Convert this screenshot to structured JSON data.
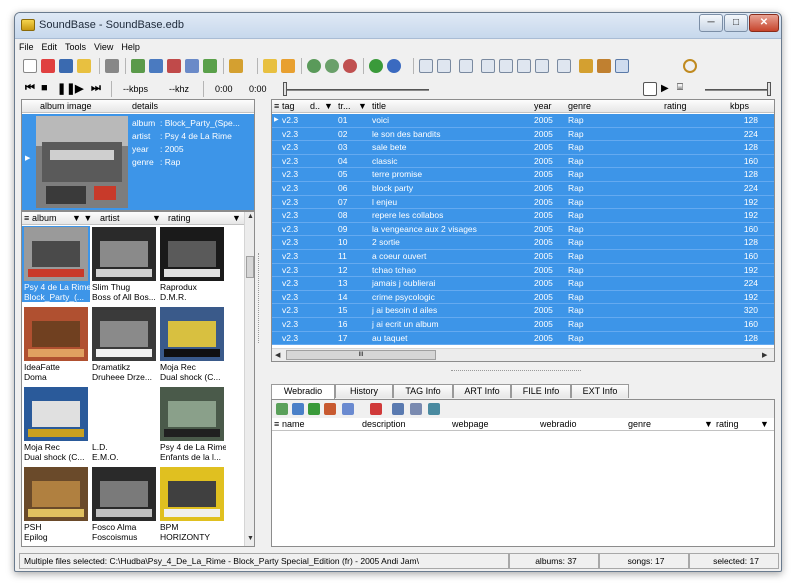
{
  "window": {
    "title": "SoundBase - SoundBase.edb",
    "buttons": {
      "minimize": "─",
      "maximize": "□",
      "close": "✕"
    }
  },
  "menu": [
    "File",
    "Edit",
    "Tools",
    "View",
    "Help"
  ],
  "player": {
    "kbps": "--kbps",
    "khz": "--khz",
    "time1": "0:00",
    "time2": "0:00"
  },
  "colors": {
    "selection": "#3d95e8",
    "window": "#f0f0f0"
  },
  "detail_panel": {
    "headers": {
      "image": "album image",
      "details": "details"
    },
    "fields": [
      {
        "key": "album",
        "value": ": Block_Party_(Spe..."
      },
      {
        "key": "artist",
        "value": ": Psy 4 de La Rime"
      },
      {
        "key": "year",
        "value": ": 2005"
      },
      {
        "key": "genre",
        "value": ": Rap"
      }
    ]
  },
  "album_browser": {
    "headers": {
      "album": "album",
      "artist": "artist",
      "rating": "rating"
    },
    "albums": [
      {
        "line1": "Psy 4 de La Rime",
        "line2": "Block_Party_(...",
        "selected": true
      },
      {
        "line1": "Slim Thug",
        "line2": "Boss of All Bos..."
      },
      {
        "line1": "Raprodux",
        "line2": "D.M.R."
      },
      {
        "line1": "IdeaFatte",
        "line2": "Doma"
      },
      {
        "line1": "Dramatikz",
        "line2": "Druheee Drze..."
      },
      {
        "line1": "Moja Rec",
        "line2": "Dual shock (C..."
      },
      {
        "line1": "Moja Rec",
        "line2": "Dual shock (C..."
      },
      {
        "line1": "L.D.",
        "line2": "E.M.O."
      },
      {
        "line1": "Psy 4 de La Rime",
        "line2": "Enfants de la l..."
      },
      {
        "line1": "PSH",
        "line2": "Epilog"
      },
      {
        "line1": "Fosco Alma",
        "line2": "Foscoismus"
      },
      {
        "line1": "BPM",
        "line2": "HORIZONTY"
      }
    ]
  },
  "tracklist": {
    "headers": {
      "tag": "tag",
      "d": "d..",
      "tr": "tr...",
      "title": "title",
      "year": "year",
      "genre": "genre",
      "rating": "rating",
      "kbps": "kbps"
    },
    "rows": [
      {
        "tag": "v2.3",
        "tr": "01",
        "title": "voici",
        "year": "2005",
        "genre": "Rap",
        "kbps": "128"
      },
      {
        "tag": "v2.3",
        "tr": "02",
        "title": "le son des bandits",
        "year": "2005",
        "genre": "Rap",
        "kbps": "224"
      },
      {
        "tag": "v2.3",
        "tr": "03",
        "title": "sale bete",
        "year": "2005",
        "genre": "Rap",
        "kbps": "128"
      },
      {
        "tag": "v2.3",
        "tr": "04",
        "title": "classic",
        "year": "2005",
        "genre": "Rap",
        "kbps": "160"
      },
      {
        "tag": "v2.3",
        "tr": "05",
        "title": "terre promise",
        "year": "2005",
        "genre": "Rap",
        "kbps": "128"
      },
      {
        "tag": "v2.3",
        "tr": "06",
        "title": "block party",
        "year": "2005",
        "genre": "Rap",
        "kbps": "224"
      },
      {
        "tag": "v2.3",
        "tr": "07",
        "title": "l enjeu",
        "year": "2005",
        "genre": "Rap",
        "kbps": "192"
      },
      {
        "tag": "v2.3",
        "tr": "08",
        "title": "repere les collabos",
        "year": "2005",
        "genre": "Rap",
        "kbps": "192"
      },
      {
        "tag": "v2.3",
        "tr": "09",
        "title": "la vengeance aux 2 visages",
        "year": "2005",
        "genre": "Rap",
        "kbps": "160"
      },
      {
        "tag": "v2.3",
        "tr": "10",
        "title": "2 sortie",
        "year": "2005",
        "genre": "Rap",
        "kbps": "128"
      },
      {
        "tag": "v2.3",
        "tr": "11",
        "title": "a coeur ouvert",
        "year": "2005",
        "genre": "Rap",
        "kbps": "160"
      },
      {
        "tag": "v2.3",
        "tr": "12",
        "title": "tchao tchao",
        "year": "2005",
        "genre": "Rap",
        "kbps": "192"
      },
      {
        "tag": "v2.3",
        "tr": "13",
        "title": "jamais j oublierai",
        "year": "2005",
        "genre": "Rap",
        "kbps": "224"
      },
      {
        "tag": "v2.3",
        "tr": "14",
        "title": "crime psycologic",
        "year": "2005",
        "genre": "Rap",
        "kbps": "192"
      },
      {
        "tag": "v2.3",
        "tr": "15",
        "title": "j ai besoin d ailes",
        "year": "2005",
        "genre": "Rap",
        "kbps": "320"
      },
      {
        "tag": "v2.3",
        "tr": "16",
        "title": "j ai ecrit un album",
        "year": "2005",
        "genre": "Rap",
        "kbps": "160"
      },
      {
        "tag": "v2.3",
        "tr": "17",
        "title": "au taquet",
        "year": "2005",
        "genre": "Rap",
        "kbps": "128"
      }
    ]
  },
  "tabs": [
    "Webradio",
    "History",
    "TAG Info",
    "ART Info",
    "FILE Info",
    "EXT Info"
  ],
  "webradio": {
    "headers": {
      "name": "name",
      "description": "description",
      "webpage": "webpage",
      "webradio": "webradio",
      "genre": "genre",
      "rating": "rating"
    }
  },
  "scroll_h_label": "III",
  "status": {
    "message": "Multiple files selected: C:\\Hudba\\Psy_4_De_La_Rime - Block_Party Special_Edition (fr) - 2005 Andi Jam\\",
    "albums": "albums: 37",
    "songs": "songs: 17",
    "selected": "selected: 17"
  }
}
